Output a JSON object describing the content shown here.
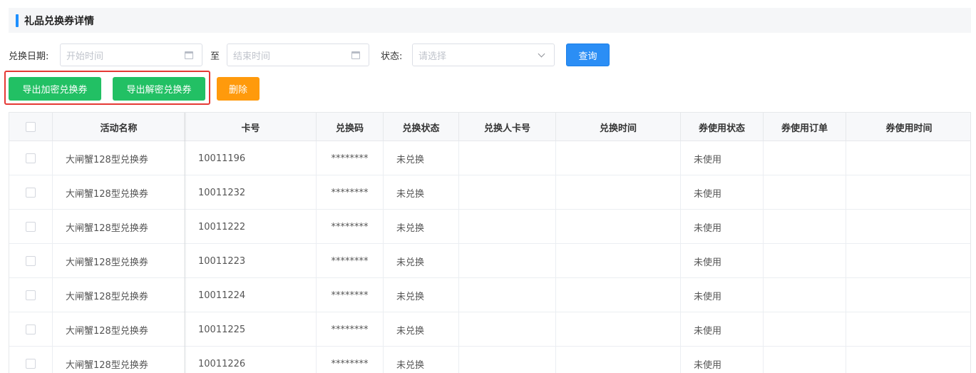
{
  "header": {
    "title": "礼品兑换券详情"
  },
  "filters": {
    "date_label": "兑换日期:",
    "start_placeholder": "开始时间",
    "to_label": "至",
    "end_placeholder": "结束时间",
    "status_label": "状态:",
    "status_placeholder": "请选择",
    "query_label": "查询"
  },
  "actions": {
    "export_encrypted": "导出加密兑换券",
    "export_decrypted": "导出解密兑换券",
    "delete": "删除"
  },
  "table": {
    "columns": [
      "活动名称",
      "卡号",
      "兑换码",
      "兑换状态",
      "兑换人卡号",
      "兑换时间",
      "券使用状态",
      "券使用订单",
      "券使用时间"
    ],
    "rows": [
      {
        "activity": "大闸蟹128型兑换券",
        "card": "10011196",
        "code": "********",
        "status": "未兑换",
        "redeemer": "",
        "redeem_time": "",
        "use_status": "未使用",
        "order": "",
        "use_time": ""
      },
      {
        "activity": "大闸蟹128型兑换券",
        "card": "10011232",
        "code": "********",
        "status": "未兑换",
        "redeemer": "",
        "redeem_time": "",
        "use_status": "未使用",
        "order": "",
        "use_time": ""
      },
      {
        "activity": "大闸蟹128型兑换券",
        "card": "10011222",
        "code": "********",
        "status": "未兑换",
        "redeemer": "",
        "redeem_time": "",
        "use_status": "未使用",
        "order": "",
        "use_time": ""
      },
      {
        "activity": "大闸蟹128型兑换券",
        "card": "10011223",
        "code": "********",
        "status": "未兑换",
        "redeemer": "",
        "redeem_time": "",
        "use_status": "未使用",
        "order": "",
        "use_time": ""
      },
      {
        "activity": "大闸蟹128型兑换券",
        "card": "10011224",
        "code": "********",
        "status": "未兑换",
        "redeemer": "",
        "redeem_time": "",
        "use_status": "未使用",
        "order": "",
        "use_time": ""
      },
      {
        "activity": "大闸蟹128型兑换券",
        "card": "10011225",
        "code": "********",
        "status": "未兑换",
        "redeemer": "",
        "redeem_time": "",
        "use_status": "未使用",
        "order": "",
        "use_time": ""
      },
      {
        "activity": "大闸蟹128型兑换券",
        "card": "10011226",
        "code": "********",
        "status": "未兑换",
        "redeemer": "",
        "redeem_time": "",
        "use_status": "未使用",
        "order": "",
        "use_time": ""
      }
    ]
  },
  "colors": {
    "accent": "#2b8ef5",
    "export": "#22c064",
    "delete": "#ff9a0c",
    "highlight": "#e53935"
  }
}
